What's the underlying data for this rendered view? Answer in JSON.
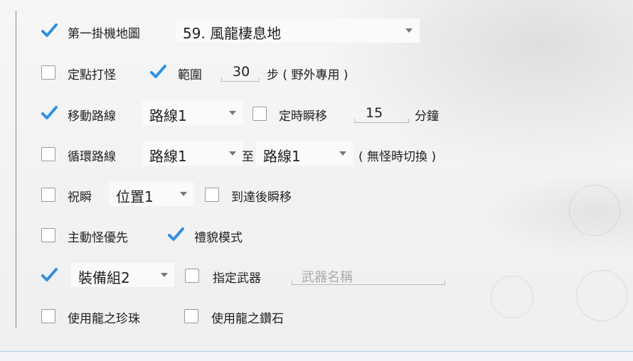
{
  "colors": {
    "check": "#2f8fdf",
    "accent_line": "#aec9e8"
  },
  "rows": [
    {
      "first_map": {
        "checked": true,
        "label": "第一掛機地圖",
        "value": "59. 風龍棲息地"
      }
    },
    {
      "fixed_point": {
        "checked": false,
        "label": "定點打怪"
      },
      "range": {
        "checked": true,
        "label": "範圍",
        "value": "30",
        "suffix": "步 ( 野外專用 )"
      }
    },
    {
      "move_route": {
        "checked": true,
        "label": "移動路線",
        "value": "路線1"
      },
      "timed_teleport": {
        "checked": false,
        "label": "定時瞬移",
        "value": "15",
        "unit": "分鐘"
      }
    },
    {
      "loop_route": {
        "checked": false,
        "label": "循環路線",
        "from": "路線1",
        "to_label": "至",
        "to": "路線1",
        "note": "( 無怪時切換 )"
      }
    },
    {
      "bless_teleport": {
        "checked": false,
        "label": "祝瞬",
        "value": "位置1"
      },
      "teleport_on_arrive": {
        "checked": false,
        "label": "到達後瞬移"
      }
    },
    {
      "active_priority": {
        "checked": false,
        "label": "主動怪優先"
      },
      "polite_mode": {
        "checked": true,
        "label": "禮貌模式"
      }
    },
    {
      "gear_set": {
        "checked": true,
        "value": "裝備組2"
      },
      "weapon": {
        "checked": false,
        "label": "指定武器",
        "placeholder": "武器名稱"
      }
    },
    {
      "dragon_pearl": {
        "checked": false,
        "label": "使用龍之珍珠"
      },
      "dragon_diamond": {
        "checked": false,
        "label": "使用龍之鑽石"
      }
    }
  ],
  "icons": {
    "checked": "checkmark-icon",
    "dropdown": "chevron-down-icon"
  }
}
